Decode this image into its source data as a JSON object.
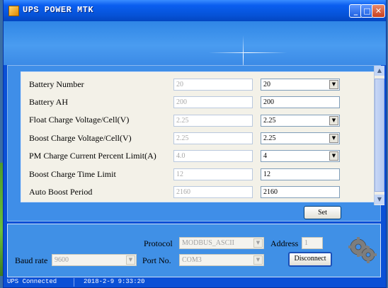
{
  "window": {
    "title": "UPS POWER MTK",
    "controls": [
      "minimize",
      "maximize",
      "close"
    ]
  },
  "settings": {
    "rows": [
      {
        "label": "Battery Number",
        "current": "20",
        "new_value": "20",
        "dropdown": true
      },
      {
        "label": "Battery AH",
        "current": "200",
        "new_value": "200",
        "dropdown": false
      },
      {
        "label": "Float Charge Voltage/Cell(V)",
        "current": "2.25",
        "new_value": "2.25",
        "dropdown": true
      },
      {
        "label": "Boost Charge Voltage/Cell(V)",
        "current": "2.25",
        "new_value": "2.25",
        "dropdown": true
      },
      {
        "label": "PM Charge Current Percent Limit(A)",
        "current": "4.0",
        "new_value": "4",
        "dropdown": true
      },
      {
        "label": "Boost Charge Time Limit",
        "current": "12",
        "new_value": "12",
        "dropdown": false
      },
      {
        "label": "Auto Boost Period",
        "current": "2160",
        "new_value": "2160",
        "dropdown": false
      }
    ],
    "set_label": "Set"
  },
  "comm": {
    "protocol_label": "Protocol",
    "protocol_value": "MODBUS_ASCII",
    "address_label": "Address",
    "address_value": "1",
    "baud_label": "Baud rate",
    "baud_value": "9600",
    "port_label": "Port No.",
    "port_value": "COM3",
    "disconnect_label": "Disconnect"
  },
  "status": {
    "connection": "UPS Connected",
    "datetime": "2018-2-9 9:33:20"
  },
  "colors": {
    "title_blue": "#0a5ef0",
    "frame_blue": "#4090e6",
    "panel_bg": "#f3f1e8"
  }
}
